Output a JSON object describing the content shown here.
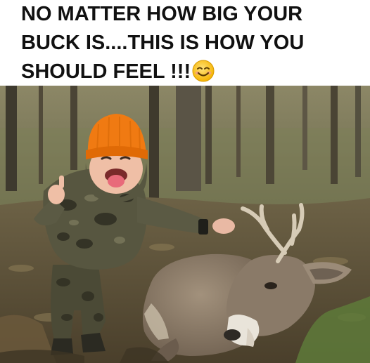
{
  "caption": {
    "line1": "NO MATTER HOW BIG YOUR",
    "line2": "BUCK IS....THIS IS HOW YOU",
    "line3": "SHOULD FEEL !!!",
    "emoji": "smiling-face-emoji"
  },
  "photo": {
    "subject": "child-with-deer-photo",
    "colors": {
      "hat": "#f07a12",
      "camo_dark": "#3b3a2a",
      "camo_light": "#6b6a52",
      "deer": "#8a7a68",
      "forest": "#6f6a4e"
    }
  }
}
